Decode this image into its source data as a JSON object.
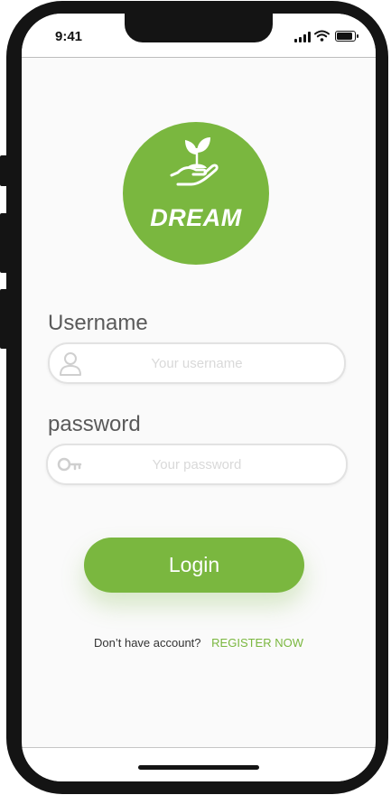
{
  "status_bar": {
    "time": "9:41"
  },
  "logo": {
    "text": "DREAM",
    "icon": "plant-in-hand-icon",
    "color": "#7ab73f"
  },
  "username": {
    "label": "Username",
    "placeholder": "Your username",
    "icon": "user-icon"
  },
  "password": {
    "label": "password",
    "placeholder": "Your password",
    "icon": "key-icon"
  },
  "login": {
    "label": "Login"
  },
  "register": {
    "question": "Don’t have account?",
    "link_label": "REGISTER NOW"
  },
  "colors": {
    "accent": "#7ab73f",
    "background": "#fafafa",
    "field_border": "#e2e2e2",
    "label": "#5a5a5a"
  }
}
